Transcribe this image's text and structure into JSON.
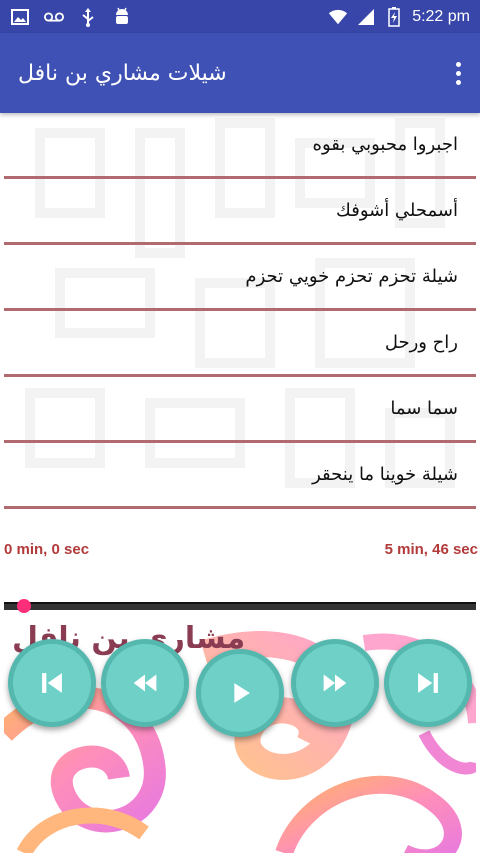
{
  "status_bar": {
    "time": "5:22 pm",
    "icons": [
      "image-icon",
      "voicemail-icon",
      "usb-icon",
      "android-icon",
      "wifi-icon",
      "signal-icon",
      "battery-icon"
    ]
  },
  "app_bar": {
    "title": "شيلات مشاري بن نافل",
    "menu_icon": "more-vert-icon"
  },
  "tracks": [
    "اجبروا محبوبي بقوه",
    "أسمحلي أشوفك",
    "شيلة تحزم تحزم خويي تحزم",
    "راح ورحل",
    "سما سما",
    "شيلة خوينا ما ينحقر"
  ],
  "player": {
    "elapsed": "0 min, 0 sec",
    "duration": "5 min, 46 sec",
    "progress": 0.0,
    "controls": [
      "skip-previous-icon",
      "rewind-icon",
      "play-icon",
      "fast-forward-icon",
      "skip-next-icon"
    ]
  },
  "banner": {
    "text": "مشاري بن نافل"
  },
  "colors": {
    "status_bar": "#3846a9",
    "app_bar": "#3f51b5",
    "divider": "#b06a70",
    "time_text": "#b23a3a",
    "control_button": "#6fd0c7",
    "seek_thumb": "#ff2e78"
  }
}
